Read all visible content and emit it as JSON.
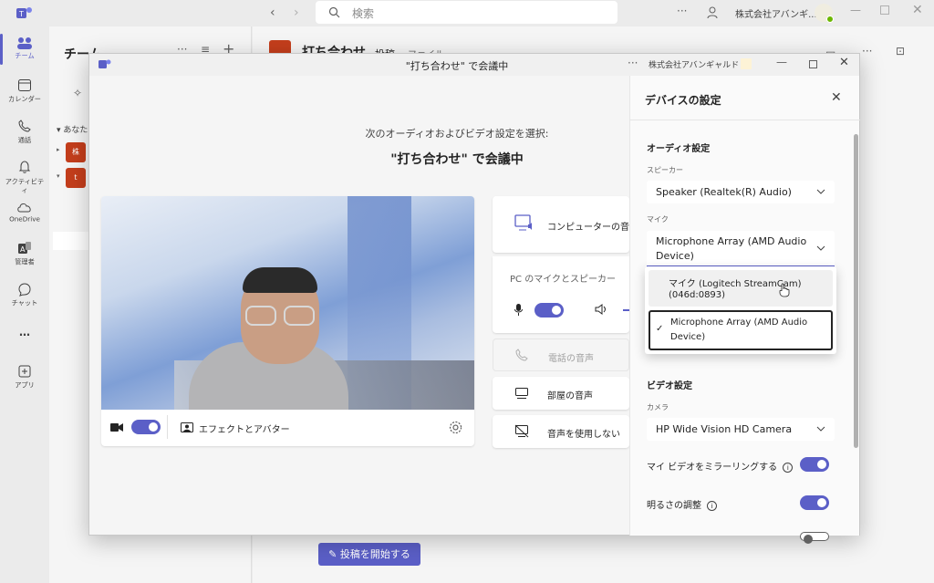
{
  "app": {
    "search_placeholder": "検索",
    "org_name": "株式会社アバンギ...",
    "rail": [
      {
        "label": "チーム",
        "icon": "teams-icon"
      },
      {
        "label": "カレンダー",
        "icon": "calendar-icon"
      },
      {
        "label": "通話",
        "icon": "phone-icon"
      },
      {
        "label": "アクティビティ",
        "icon": "bell-icon"
      },
      {
        "label": "OneDrive",
        "icon": "cloud-icon"
      },
      {
        "label": "管理者",
        "icon": "admin-icon"
      },
      {
        "label": "チャット",
        "icon": "chat-icon"
      },
      {
        "label": "…",
        "icon": "more-icon"
      },
      {
        "label": "アプリ",
        "icon": "apps-icon"
      }
    ],
    "teams_header": "チーム",
    "section_label": "あなた",
    "team_avatars": [
      "株",
      "t"
    ],
    "channel_title": "打ち合わせ",
    "channel_tabs": [
      "投稿",
      "ファイル"
    ],
    "start_post_button": "投稿を開始する"
  },
  "dialog": {
    "window_title": "\"打ち合わせ\" で会議中",
    "org_name": "株式会社アバンギャルド",
    "subtitle": "次のオーディオおよびビデオ設定を選択:",
    "heading": "\"打ち合わせ\" で会議中",
    "effects_label": "エフェクトとアバター",
    "audio_options": {
      "computer_audio": "コンピューターの音声",
      "pc_mic_speaker": "PC のマイクとスピーカー",
      "phone_audio": "電話の音声",
      "room_audio": "部屋の音声",
      "no_audio": "音声を使用しない"
    },
    "camera_on": true,
    "mic_on": true
  },
  "device_settings": {
    "title": "デバイスの設定",
    "audio_section": "オーディオ設定",
    "speaker_label": "スピーカー",
    "speaker_value": "Speaker (Realtek(R) Audio)",
    "mic_label": "マイク",
    "mic_value_line1": "Microphone Array (AMD Audio",
    "mic_value_line2": "Device)",
    "mic_options": [
      {
        "line1": "マイク (Logitech StreamCam)",
        "line2": "(046d:0893)",
        "selected": false
      },
      {
        "line1": "Microphone Array (AMD Audio",
        "line2": "Device)",
        "selected": true
      }
    ],
    "video_section": "ビデオ設定",
    "camera_label": "カメラ",
    "camera_value": "HP Wide Vision HD Camera",
    "mirror_label": "マイ ビデオをミラーリングする",
    "mirror_on": true,
    "brightness_label": "明るさの調整",
    "brightness_on": true,
    "accent_color": "#5b5fc7"
  }
}
